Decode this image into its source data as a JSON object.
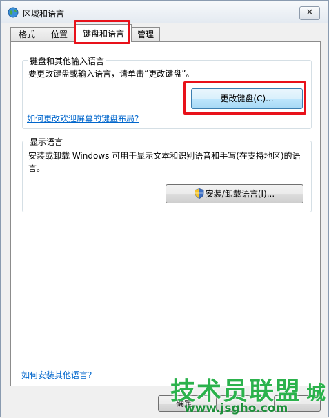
{
  "window": {
    "title": "区域和语言",
    "close_glyph": "✕"
  },
  "tabs": [
    {
      "label": "格式"
    },
    {
      "label": "位置"
    },
    {
      "label": "键盘和语言",
      "active": true
    },
    {
      "label": "管理"
    }
  ],
  "keyboard_group": {
    "title": "键盘和其他输入语言",
    "description": "要更改键盘或输入语言，请单击“更改键盘”。",
    "change_keyboard_button": "更改键盘(C)...",
    "welcome_layout_link": "如何更改欢迎屏幕的键盘布局?"
  },
  "display_group": {
    "title": "显示语言",
    "description_line1": "安装或卸载 Windows 可用于显示文本和识别语音和手写(在支持地区)的语",
    "description_line2": "言。",
    "install_button": "安装/卸载语言(I)..."
  },
  "footer": {
    "install_languages_link": "如何安装其他语言?",
    "ok_button": "确定"
  },
  "watermark": {
    "main": "技术员联盟",
    "side": "城",
    "url": "www.jsgho.com"
  },
  "colors": {
    "highlight": "#e8111a",
    "link": "#0066cc",
    "watermark": "#2bb24c"
  },
  "icons": {
    "title": "globe-icon",
    "uac": "uac-shield-icon"
  }
}
